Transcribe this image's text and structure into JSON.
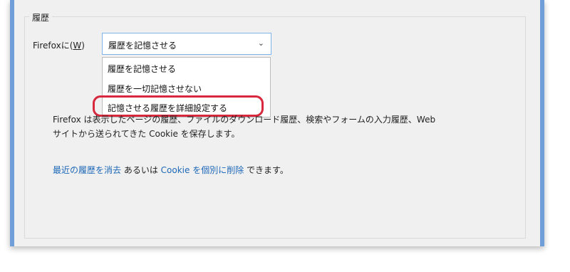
{
  "section": {
    "title": "履歴"
  },
  "history_mode": {
    "label": "Firefoxに(",
    "accesskey": "W",
    "label_end": ")",
    "selected": "履歴を記憶させる",
    "options": [
      "履歴を記憶させる",
      "履歴を一切記憶させない",
      "記憶させる履歴を詳細設定する"
    ]
  },
  "description": {
    "line1": "Firefox は表示したページの履歴、ファイルのダウンロード履歴、検索やフォームの入力履歴、Web",
    "line2": "サイトから送られてきた Cookie を保存します。"
  },
  "actions": {
    "clear_recent": "最近の履歴を消去",
    "or": " あるいは ",
    "remove_cookies": "Cookie を個別に削除",
    "suffix": " できます。"
  },
  "colors": {
    "highlight": "#d8283d",
    "link": "#1d67b8",
    "accent_edge": "#6f9ed8"
  },
  "icons": {
    "chevron": "chevron-down-icon"
  }
}
